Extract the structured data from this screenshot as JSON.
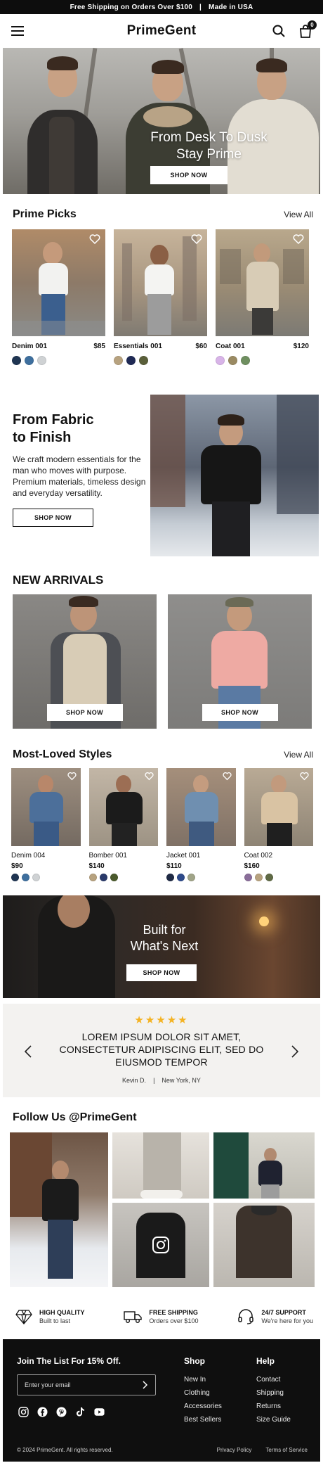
{
  "announcement": {
    "shipping": "Free Shipping on Orders Over $100",
    "sep": "|",
    "made": "Made in USA"
  },
  "header": {
    "logo": "PrimeGent",
    "cart_count": "0"
  },
  "hero": {
    "title_line1": "From Desk To Dusk",
    "title_line2": "Stay Prime",
    "cta": "SHOP NOW"
  },
  "prime_picks": {
    "title": "Prime Picks",
    "view_all": "View All",
    "items": [
      {
        "name": "Denim 001",
        "price": "$85",
        "swatches": [
          "#1f3552",
          "#3e6f9e",
          "#cfd2d4"
        ]
      },
      {
        "name": "Essentials 001",
        "price": "$60",
        "swatches": [
          "#b7a27f",
          "#1f2a55",
          "#5a5f3a"
        ]
      },
      {
        "name": "Coat 001",
        "price": "$120",
        "swatches": [
          "#d8b4e8",
          "#9a8a62",
          "#6f8f60"
        ]
      }
    ]
  },
  "fabric": {
    "title_line1": "From Fabric",
    "title_line2": "to Finish",
    "body": "We craft modern essentials for the man who moves with purpose. Premium materials, timeless design and everyday versatility.",
    "cta": "SHOP NOW"
  },
  "new_arrivals": {
    "title": "NEW ARRIVALS",
    "cta_left": "SHOP NOW",
    "cta_right": "SHOP NOW"
  },
  "most_loved": {
    "title": "Most-Loved Styles",
    "view_all": "View All",
    "items": [
      {
        "name": "Denim 004",
        "price": "$90",
        "swatches": [
          "#1f3552",
          "#3e6f9e",
          "#cfd2d4"
        ]
      },
      {
        "name": "Bomber 001",
        "price": "$140",
        "swatches": [
          "#b7a27f",
          "#2a3a6a",
          "#4b5a2c"
        ]
      },
      {
        "name": "Jacket 001",
        "price": "$110",
        "swatches": [
          "#1f2a45",
          "#2e4a8a",
          "#a0a488"
        ]
      },
      {
        "name": "Coat 002",
        "price": "$160",
        "swatches": [
          "#8a6e9a",
          "#b7a27f",
          "#5f6a45"
        ]
      }
    ]
  },
  "built": {
    "title_line1": "Built for",
    "title_line2": "What's Next",
    "cta": "SHOP NOW"
  },
  "testimonial": {
    "stars": "★★★★★",
    "quote": "LOREM IPSUM DOLOR SIT AMET, CONSECTETUR ADIPISCING ELIT, SED DO EIUSMOD TEMPOR",
    "author": "Kevin D.",
    "sep": "|",
    "location": "New York, NY"
  },
  "follow": {
    "title": "Follow Us @PrimeGent"
  },
  "features": [
    {
      "title": "HIGH QUALITY",
      "subtitle": "Built to last"
    },
    {
      "title": "FREE SHIPPING",
      "subtitle": "Orders over $100"
    },
    {
      "title": "24/7 SUPPORT",
      "subtitle": "We're here for you"
    }
  ],
  "footer": {
    "join": "Join The List For 15% Off.",
    "email_placeholder": "Enter your email",
    "shop": {
      "title": "Shop",
      "links": [
        "New In",
        "Clothing",
        "Accessories",
        "Best Sellers"
      ]
    },
    "help": {
      "title": "Help",
      "links": [
        "Contact",
        "Shipping",
        "Returns",
        "Size Guide"
      ]
    },
    "copyright": "© 2024 PrimeGent. All rights reserved.",
    "privacy": "Privacy Policy",
    "terms": "Terms of Service"
  },
  "colors": {
    "brand_dark": "#0f0f0f",
    "star": "#f4b323",
    "testimonial_bg": "#f3f2f0"
  },
  "icons": [
    "menu-icon",
    "search-icon",
    "bag-icon",
    "heart-icon",
    "chevron-left-icon",
    "chevron-right-icon",
    "instagram-icon",
    "diamond-icon",
    "truck-icon",
    "headset-icon",
    "arrow-right-icon",
    "facebook-icon",
    "pinterest-icon",
    "tiktok-icon",
    "youtube-icon"
  ]
}
